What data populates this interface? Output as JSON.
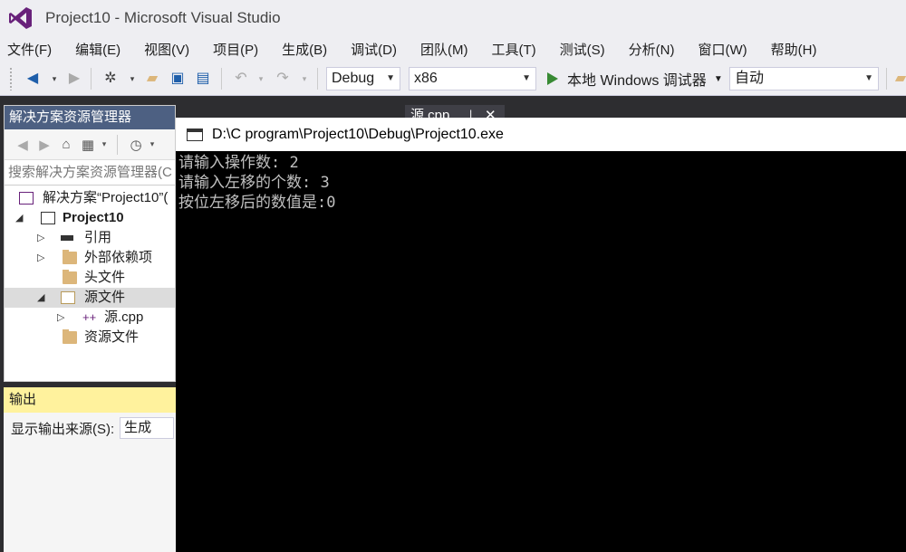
{
  "window": {
    "title": "Project10 - Microsoft Visual Studio"
  },
  "menu": [
    "文件(F)",
    "编辑(E)",
    "视图(V)",
    "项目(P)",
    "生成(B)",
    "调试(D)",
    "团队(M)",
    "工具(T)",
    "测试(S)",
    "分析(N)",
    "窗口(W)",
    "帮助(H)"
  ],
  "toolbar": {
    "config": "Debug",
    "platform": "x86",
    "run_label": "本地 Windows 调试器",
    "auto": "自动"
  },
  "solution_explorer": {
    "title": "解决方案资源管理器",
    "search_placeholder": "搜索解决方案资源管理器(C",
    "nodes": {
      "solution": "解决方案“Project10”(",
      "project": "Project10",
      "references": "引用",
      "external": "外部依赖项",
      "headers": "头文件",
      "sources": "源文件",
      "source_cpp": "源.cpp",
      "resources": "资源文件"
    }
  },
  "output": {
    "title": "输出",
    "source_label": "显示输出来源(S):",
    "source_value": "生成"
  },
  "editor": {
    "tab": "源.cpp"
  },
  "console": {
    "title": "D:\\C program\\Project10\\Debug\\Project10.exe",
    "lines": [
      "请输入操作数: 2",
      "请输入左移的个数: 3",
      "按位左移后的数值是:0"
    ]
  },
  "colors": {
    "title_bg": "#eeeef2",
    "panel_header": "#4d6082",
    "output_header": "#fff29d",
    "console_bg": "#000000",
    "console_text": "#c0c0c0",
    "run_green": "#388a34"
  }
}
